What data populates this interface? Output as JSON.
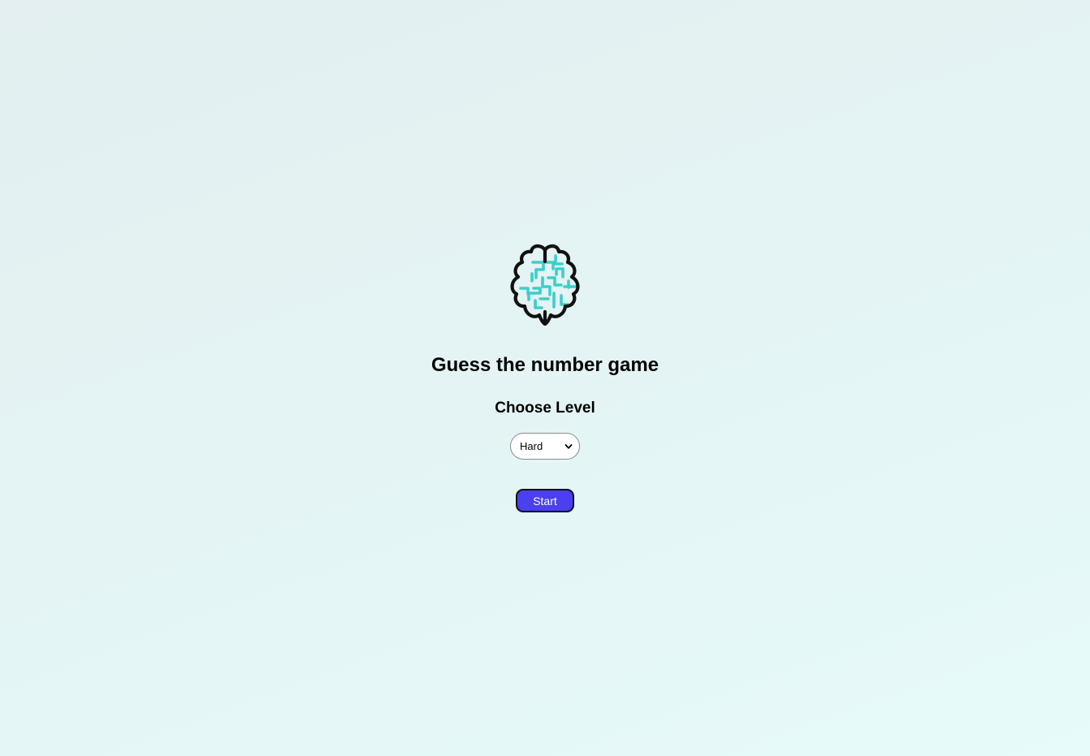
{
  "page": {
    "title": "Guess the number game",
    "subtitle": "Choose Level",
    "logo_icon": "brain-maze-icon"
  },
  "level_select": {
    "selected": "Hard",
    "options": [
      "Hard"
    ]
  },
  "start_button": {
    "label": "Start"
  },
  "colors": {
    "accent": "#4b3ff2",
    "logo_teal": "#3dcfcb",
    "logo_outline": "#111111"
  }
}
